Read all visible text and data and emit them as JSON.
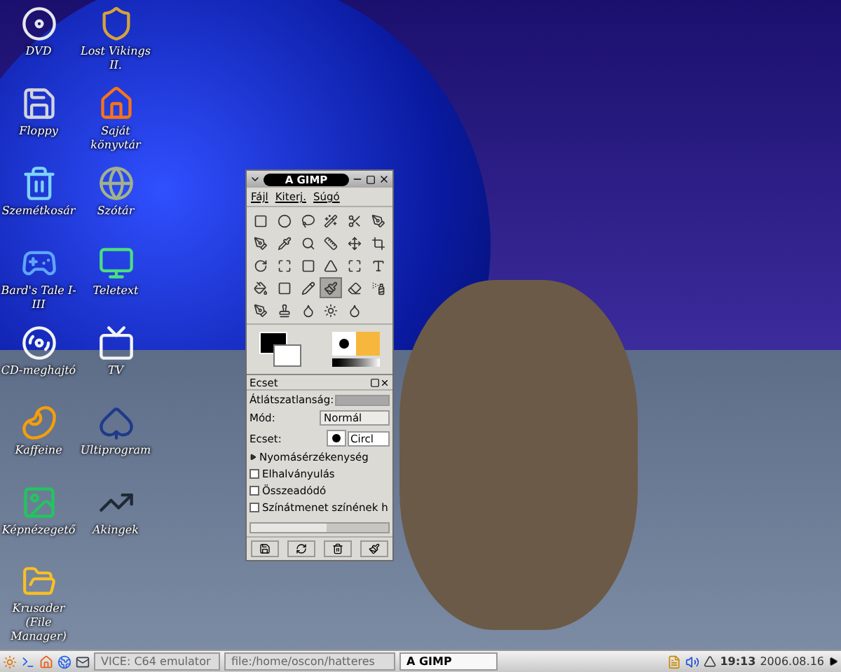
{
  "desktop_icons": [
    {
      "label": "DVD"
    },
    {
      "label": "Lost Vikings II."
    },
    {
      "label": "Floppy"
    },
    {
      "label": "Saját könyvtár"
    },
    {
      "label": "Szemétkosár"
    },
    {
      "label": "Szótár"
    },
    {
      "label": "Bard's Tale I-III"
    },
    {
      "label": "Teletext"
    },
    {
      "label": "CD-meghajtó"
    },
    {
      "label": "TV"
    },
    {
      "label": "Kaffeine"
    },
    {
      "label": "Ultiprogram"
    },
    {
      "label": "Képnézegető"
    },
    {
      "label": "Akingek"
    },
    {
      "label": "Krusader (File Manager)"
    }
  ],
  "gimp_window": {
    "title": "A GIMP",
    "menu": [
      "Fájl",
      "Kiterj.",
      "Súgó"
    ],
    "tools": [
      {
        "selected": false
      },
      {
        "selected": false
      },
      {
        "selected": false
      },
      {
        "selected": false
      },
      {
        "selected": false
      },
      {
        "selected": false
      },
      {
        "selected": false
      },
      {
        "selected": false
      },
      {
        "selected": false
      },
      {
        "selected": false
      },
      {
        "selected": false
      },
      {
        "selected": false
      },
      {
        "selected": false
      },
      {
        "selected": false
      },
      {
        "selected": false
      },
      {
        "selected": false
      },
      {
        "selected": false
      },
      {
        "selected": false
      },
      {
        "selected": false
      },
      {
        "selected": false
      },
      {
        "selected": false
      },
      {
        "selected": true
      },
      {
        "selected": false
      },
      {
        "selected": false
      },
      {
        "selected": false
      },
      {
        "selected": false
      },
      {
        "selected": false
      },
      {
        "selected": false
      },
      {
        "selected": false
      }
    ],
    "brush_dock": {
      "title": "Ecset",
      "opacity_label": "Átlátszatlanság:",
      "opacity": {
        "level": 1
      },
      "mode_label": "Mód:",
      "mode": "Normál",
      "brush_label": "Ecset:",
      "brush": "Circl",
      "expander": "Nyomásérzékenység",
      "options": [
        {
          "label": "Elhalványulás",
          "checked": false
        },
        {
          "label": "Összeadódó",
          "checked": false
        },
        {
          "label": "Színátmenet színének h",
          "checked": false
        }
      ]
    }
  },
  "taskbar": {
    "tasks": [
      {
        "label": "VICE: C64 emulator",
        "selected": false
      },
      {
        "label": "file:/home/oscon/hatteres",
        "selected": false
      },
      {
        "label": "A GIMP",
        "selected": true
      }
    ],
    "time": "19:13",
    "date": "2006.08.16"
  }
}
